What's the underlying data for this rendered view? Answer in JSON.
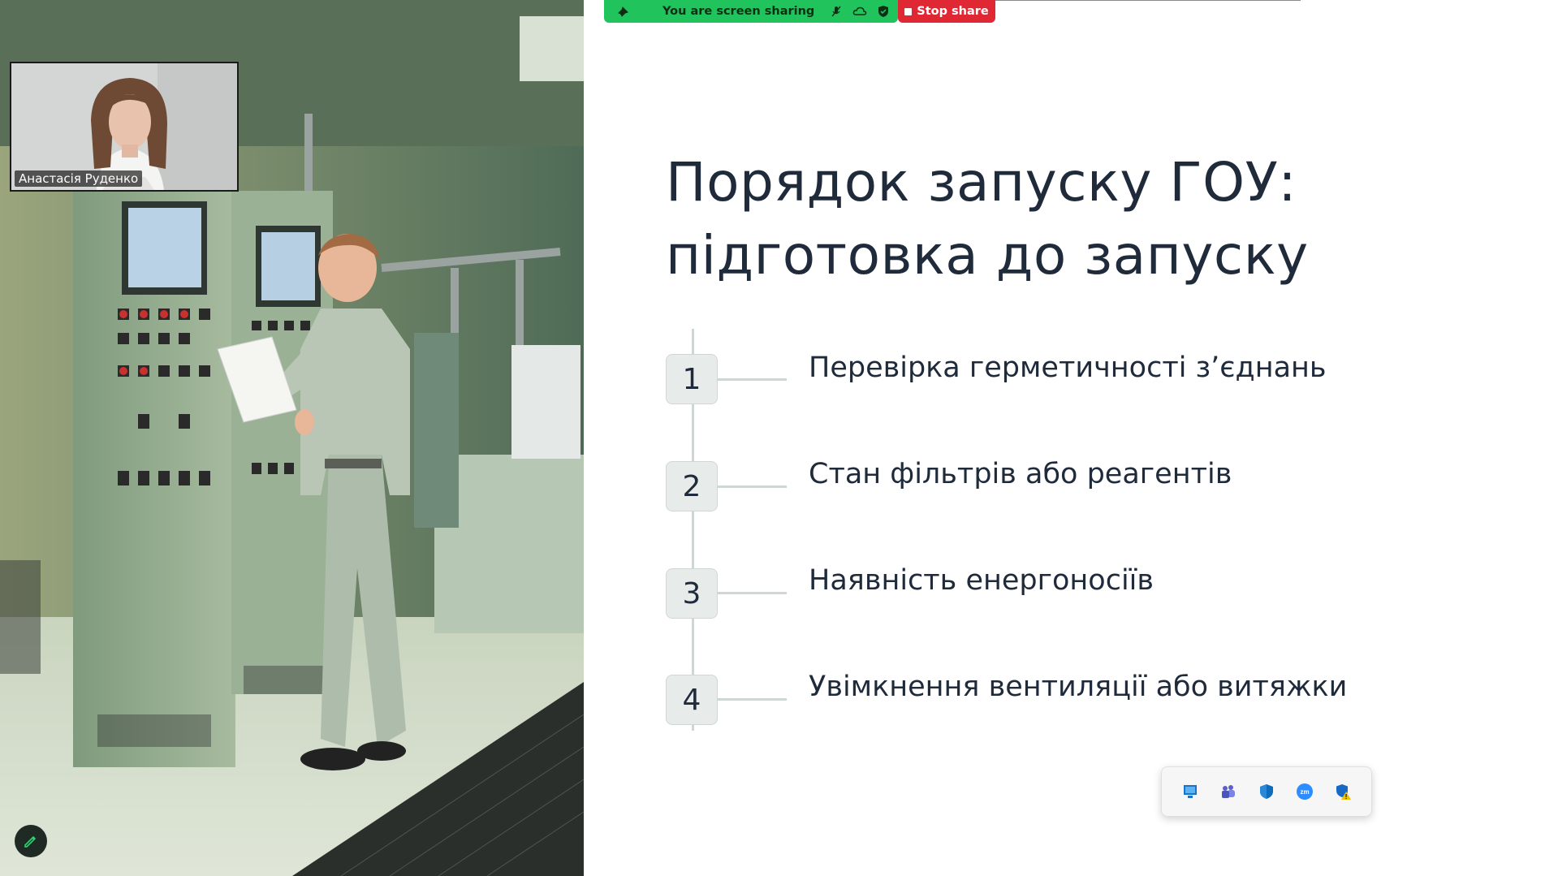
{
  "participant": {
    "name": "Анастасія Руденко"
  },
  "share_bar": {
    "status_text": "You are screen sharing",
    "stop_label": "Stop share",
    "color": "#21c35c",
    "stop_color": "#e02834",
    "icons": [
      "pin-icon",
      "mic-off-icon",
      "cloud-icon",
      "shield-check-icon"
    ]
  },
  "slide": {
    "title_line1": "Порядок запуску ГОУ:",
    "title_line2": "підготовка до запуску",
    "steps": [
      {
        "number": "1",
        "text": "Перевірка герметичності з’єднань"
      },
      {
        "number": "2",
        "text": "Стан фільтрів або реагентів"
      },
      {
        "number": "3",
        "text": "Наявність енергоносіїв"
      },
      {
        "number": "4",
        "text": "Увімкнення вентиляції або витяжки"
      }
    ]
  },
  "tray": {
    "icons": [
      "remote-desktop-icon",
      "teams-icon",
      "defender-icon",
      "zoom-icon",
      "security-warning-icon"
    ]
  }
}
